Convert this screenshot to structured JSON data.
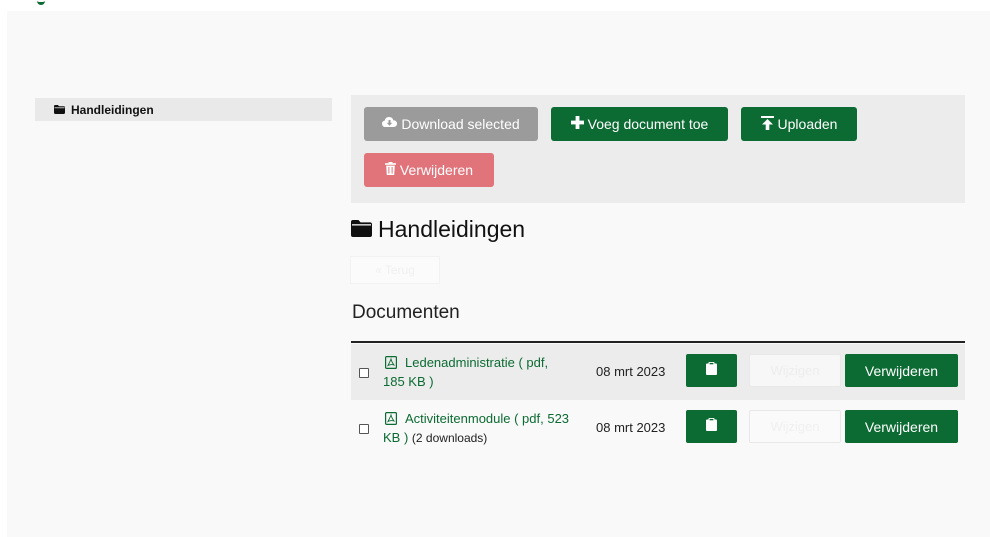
{
  "sidebar": {
    "items": [
      {
        "label": "Handleidingen",
        "icon": "folder-icon"
      }
    ]
  },
  "toolbar": {
    "download_label": "Download selected",
    "add_label": "Voeg document toe",
    "upload_label": "Uploaden",
    "delete_label": "Verwijderen"
  },
  "folder": {
    "title": "Handleidingen",
    "ghost_label": "« Terug"
  },
  "documents": {
    "heading": "Documenten",
    "rows": [
      {
        "name": "Ledenadministratie ( pdf, 185 KB )",
        "extra": "",
        "date": "08 mrt 2023",
        "edit_label": "Wijzigen",
        "delete_label": "Verwijderen"
      },
      {
        "name": "Activiteitenmodule ( pdf, 523 KB )",
        "extra": "(2 downloads)",
        "date": "08 mrt 2023",
        "edit_label": "Wijzigen",
        "delete_label": "Verwijderen"
      }
    ]
  },
  "colors": {
    "primary": "#0b6b32",
    "disabled": "#9b9b9b",
    "danger": "#e0747a",
    "panel": "#ececec"
  }
}
